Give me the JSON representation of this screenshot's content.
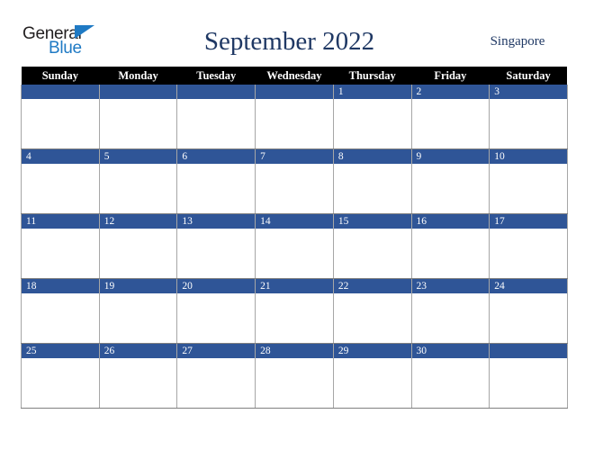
{
  "logo": {
    "text_primary": "General",
    "text_secondary": "Blue",
    "icon": "blue-triangle-icon",
    "color_primary": "#221f20",
    "color_secondary": "#1f7ac4"
  },
  "header": {
    "title": "September 2022",
    "location": "Singapore",
    "title_color": "#1f3864"
  },
  "theme": {
    "header_row_bg": "#000000",
    "header_row_text": "#ffffff",
    "date_bar_bg": "#2f5597",
    "date_bar_text": "#ffffff",
    "cell_bg": "#ffffff",
    "border_color": "#a6a6a6"
  },
  "weekday_headers": [
    "Sunday",
    "Monday",
    "Tuesday",
    "Wednesday",
    "Thursday",
    "Friday",
    "Saturday"
  ],
  "weeks": [
    {
      "days": [
        {
          "date": ""
        },
        {
          "date": ""
        },
        {
          "date": ""
        },
        {
          "date": ""
        },
        {
          "date": "1"
        },
        {
          "date": "2"
        },
        {
          "date": "3"
        }
      ]
    },
    {
      "days": [
        {
          "date": "4"
        },
        {
          "date": "5"
        },
        {
          "date": "6"
        },
        {
          "date": "7"
        },
        {
          "date": "8"
        },
        {
          "date": "9"
        },
        {
          "date": "10"
        }
      ]
    },
    {
      "days": [
        {
          "date": "11"
        },
        {
          "date": "12"
        },
        {
          "date": "13"
        },
        {
          "date": "14"
        },
        {
          "date": "15"
        },
        {
          "date": "16"
        },
        {
          "date": "17"
        }
      ]
    },
    {
      "days": [
        {
          "date": "18"
        },
        {
          "date": "19"
        },
        {
          "date": "20"
        },
        {
          "date": "21"
        },
        {
          "date": "22"
        },
        {
          "date": "23"
        },
        {
          "date": "24"
        }
      ]
    },
    {
      "days": [
        {
          "date": "25"
        },
        {
          "date": "26"
        },
        {
          "date": "27"
        },
        {
          "date": "28"
        },
        {
          "date": "29"
        },
        {
          "date": "30"
        },
        {
          "date": ""
        }
      ]
    }
  ]
}
